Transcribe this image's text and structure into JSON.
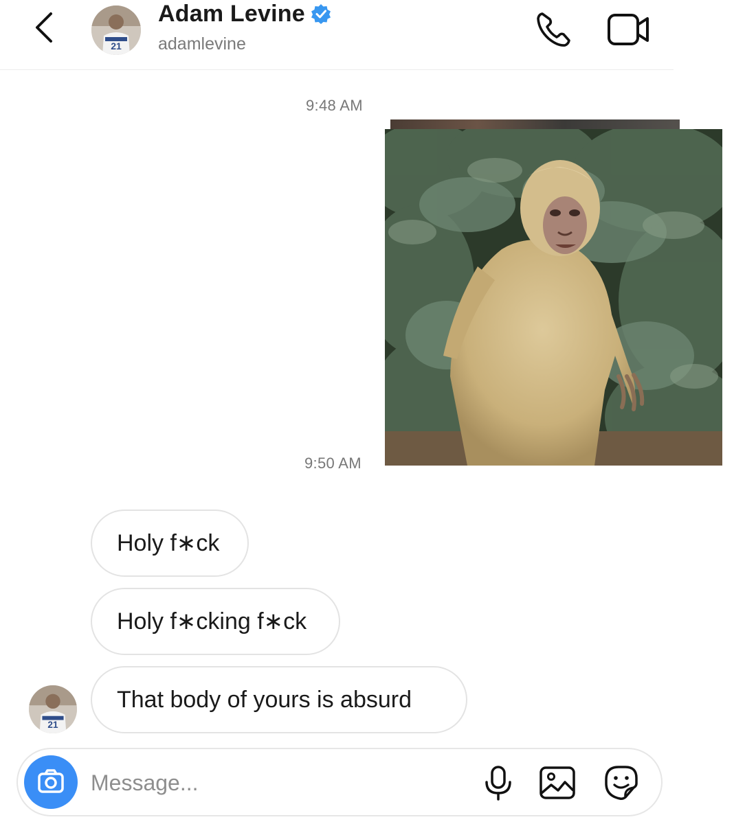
{
  "header": {
    "contact_name": "Adam Levine",
    "username": "adamlevine",
    "avatar_jersey_number": "21",
    "verified_badge": "verified-icon",
    "icons": {
      "back": "chevron-left-icon",
      "call": "phone-icon",
      "video": "video-camera-icon"
    }
  },
  "conversation": {
    "timestamps": [
      "9:48 AM",
      "9:50 AM"
    ],
    "sent_photo": {
      "type": "image",
      "subject": "bigfoot"
    },
    "received_messages": [
      {
        "text": "Holy f∗ck"
      },
      {
        "text": "Holy f∗cking f∗ck"
      },
      {
        "text": "That body of yours is absurd"
      }
    ],
    "sender_avatar_jersey_number": "21"
  },
  "composer": {
    "placeholder": "Message...",
    "value": "",
    "icons": {
      "camera": "camera-icon",
      "microphone": "microphone-icon",
      "gallery": "image-icon",
      "sticker": "sticker-icon"
    }
  },
  "colors": {
    "accent_blue": "#3a8ef6",
    "verified_blue": "#3897f0",
    "bubble_border": "#e3e3e3",
    "timestamp_gray": "#777777"
  }
}
